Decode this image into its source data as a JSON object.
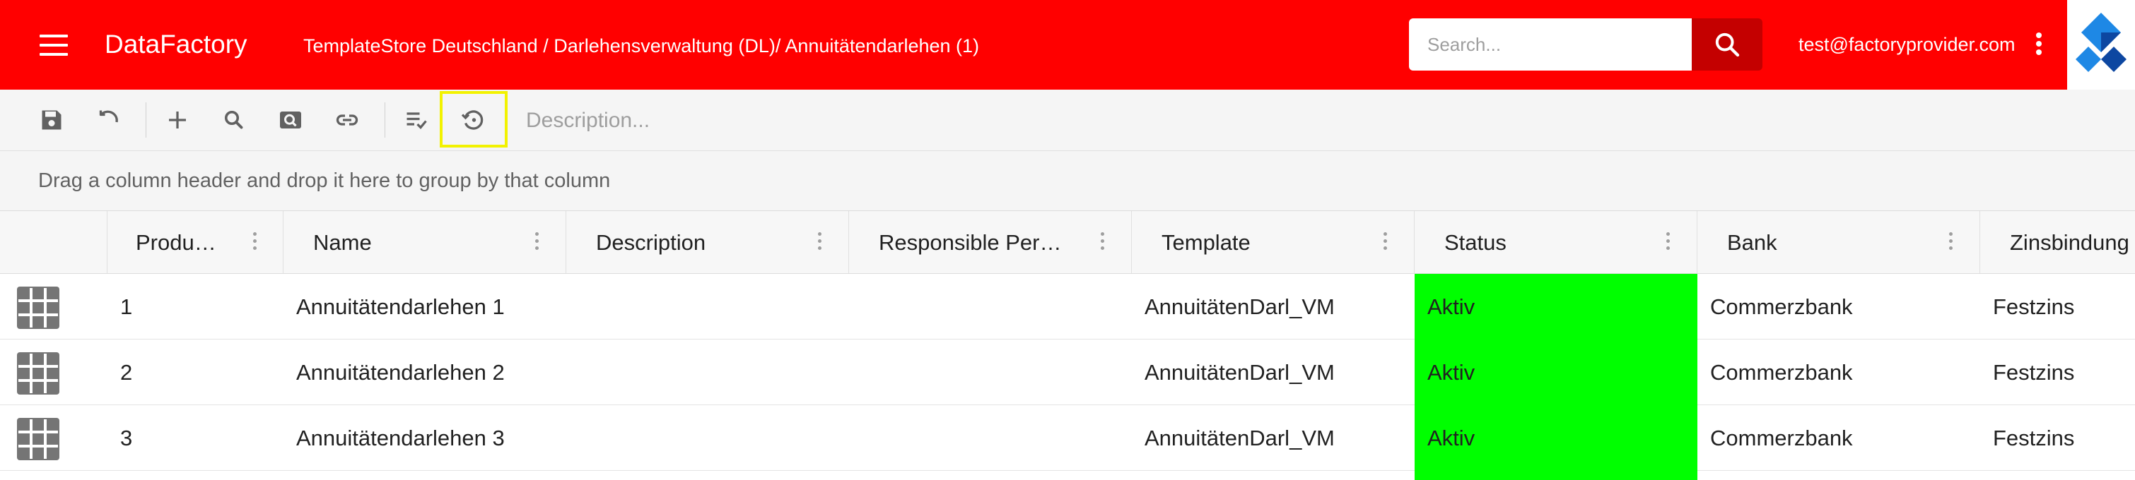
{
  "header": {
    "app_title": "DataFactory",
    "breadcrumb": "TemplateStore Deutschland / Darlehensverwaltung (DL)/ Annuitätendarlehen (1)",
    "search_placeholder": "Search...",
    "user_email": "test@factoryprovider.com",
    "icons": {
      "menu": "hamburger-menu-icon",
      "search": "search-icon",
      "more": "kebab-menu-icon",
      "logo": "datafactory-logo"
    }
  },
  "toolbar": {
    "description_placeholder": "Description...",
    "buttons": [
      "save-icon",
      "undo-icon",
      "add-icon",
      "search-icon",
      "preview-icon",
      "link-icon",
      "checklist-icon",
      "restore-history-icon"
    ],
    "highlighted_button": "restore-history-icon"
  },
  "group_panel": {
    "text": "Drag a column header and drop it here to group by that column"
  },
  "grid": {
    "columns": [
      "Produ…",
      "Name",
      "Description",
      "Responsible Per…",
      "Template",
      "Status",
      "Bank",
      "Zinsbindung"
    ],
    "rows": [
      {
        "id": "1",
        "name": "Annuitätendarlehen 1",
        "description": "",
        "responsible": "",
        "template": "AnnuitätenDarl_VM",
        "status": "Aktiv",
        "bank": "Commerzbank",
        "zinsbindung": "Festzins"
      },
      {
        "id": "2",
        "name": "Annuitätendarlehen 2",
        "description": "",
        "responsible": "",
        "template": "AnnuitätenDarl_VM",
        "status": "Aktiv",
        "bank": "Commerzbank",
        "zinsbindung": "Festzins"
      },
      {
        "id": "3",
        "name": "Annuitätendarlehen 3",
        "description": "",
        "responsible": "",
        "template": "AnnuitätenDarl_VM",
        "status": "Aktiv",
        "bank": "Commerzbank",
        "zinsbindung": "Festzins"
      }
    ],
    "row_icon": "grid-view-icon"
  },
  "colors": {
    "header_bg": "#ff0000",
    "search_button_bg": "#c40000",
    "status_active": "#00ff00",
    "highlight": "#f2f200",
    "toolbar_icon": "#616161",
    "logo_light": "#1e88e5",
    "logo_dark": "#0d47a1"
  }
}
